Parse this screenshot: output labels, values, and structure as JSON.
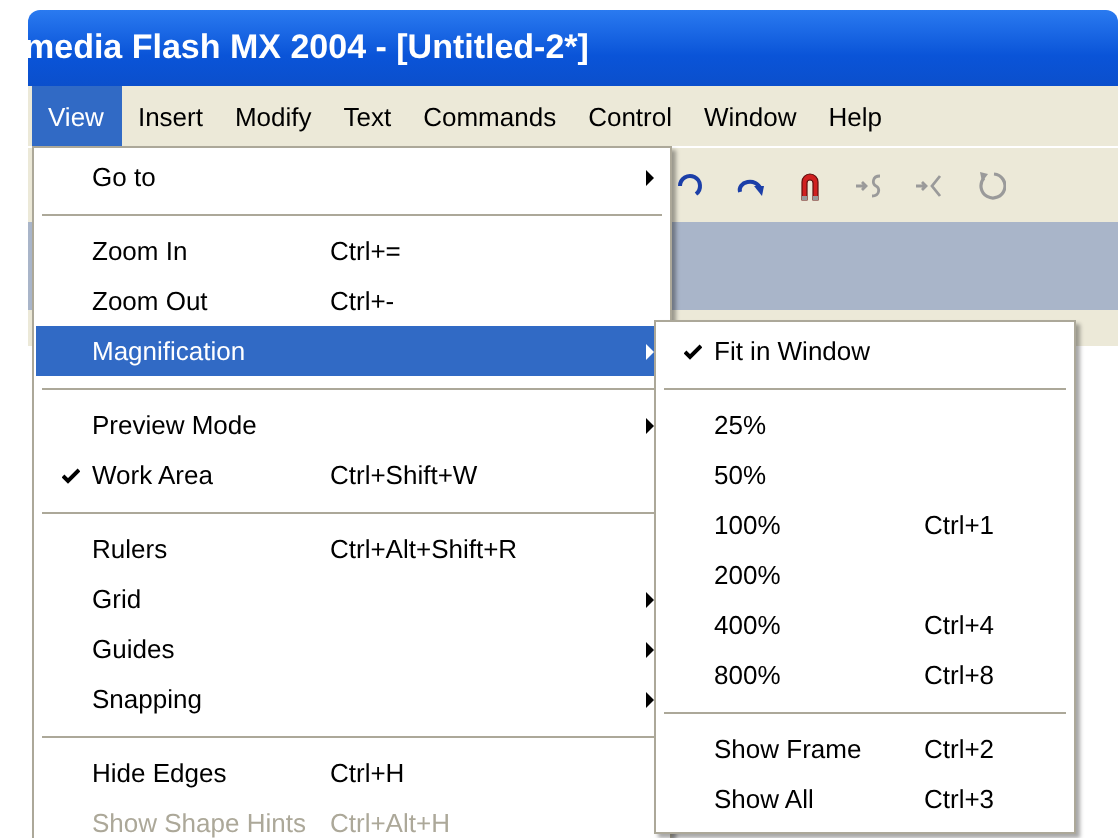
{
  "window": {
    "title": "media Flash MX 2004 - [Untitled-2*]"
  },
  "menubar": [
    {
      "label": "View",
      "selected": true
    },
    {
      "label": "Insert",
      "selected": false
    },
    {
      "label": "Modify",
      "selected": false
    },
    {
      "label": "Text",
      "selected": false
    },
    {
      "label": "Commands",
      "selected": false
    },
    {
      "label": "Control",
      "selected": false
    },
    {
      "label": "Window",
      "selected": false
    },
    {
      "label": "Help",
      "selected": false
    }
  ],
  "view_menu": [
    {
      "kind": "item",
      "label": "Go to",
      "has_submenu": true,
      "checked": false,
      "selected": false,
      "disabled": false
    },
    {
      "kind": "separator"
    },
    {
      "kind": "item",
      "label": "Zoom In",
      "shortcut": "Ctrl+=",
      "checked": false,
      "selected": false,
      "disabled": false
    },
    {
      "kind": "item",
      "label": "Zoom Out",
      "shortcut": "Ctrl+-",
      "checked": false,
      "selected": false,
      "disabled": false
    },
    {
      "kind": "item",
      "label": "Magnification",
      "has_submenu": true,
      "checked": false,
      "selected": true,
      "disabled": false
    },
    {
      "kind": "separator"
    },
    {
      "kind": "item",
      "label": "Preview Mode",
      "has_submenu": true,
      "checked": false,
      "selected": false,
      "disabled": false
    },
    {
      "kind": "item",
      "label": "Work Area",
      "shortcut": "Ctrl+Shift+W",
      "checked": true,
      "selected": false,
      "disabled": false
    },
    {
      "kind": "separator"
    },
    {
      "kind": "item",
      "label": "Rulers",
      "shortcut": "Ctrl+Alt+Shift+R",
      "checked": false,
      "selected": false,
      "disabled": false
    },
    {
      "kind": "item",
      "label": "Grid",
      "has_submenu": true,
      "checked": false,
      "selected": false,
      "disabled": false
    },
    {
      "kind": "item",
      "label": "Guides",
      "has_submenu": true,
      "checked": false,
      "selected": false,
      "disabled": false
    },
    {
      "kind": "item",
      "label": "Snapping",
      "has_submenu": true,
      "checked": false,
      "selected": false,
      "disabled": false
    },
    {
      "kind": "separator"
    },
    {
      "kind": "item",
      "label": "Hide Edges",
      "shortcut": "Ctrl+H",
      "checked": false,
      "selected": false,
      "disabled": false
    },
    {
      "kind": "item",
      "label": "Show Shape Hints",
      "shortcut": "Ctrl+Alt+H",
      "checked": false,
      "selected": false,
      "disabled": true
    }
  ],
  "magnification_menu": [
    {
      "kind": "item",
      "label": "Fit in Window",
      "checked": true,
      "selected": false,
      "disabled": false
    },
    {
      "kind": "separator"
    },
    {
      "kind": "item",
      "label": "25%",
      "checked": false,
      "selected": false,
      "disabled": false
    },
    {
      "kind": "item",
      "label": "50%",
      "checked": false,
      "selected": false,
      "disabled": false
    },
    {
      "kind": "item",
      "label": "100%",
      "shortcut": "Ctrl+1",
      "checked": false,
      "selected": false,
      "disabled": false
    },
    {
      "kind": "item",
      "label": "200%",
      "checked": false,
      "selected": false,
      "disabled": false
    },
    {
      "kind": "item",
      "label": "400%",
      "shortcut": "Ctrl+4",
      "checked": false,
      "selected": false,
      "disabled": false
    },
    {
      "kind": "item",
      "label": "800%",
      "shortcut": "Ctrl+8",
      "checked": false,
      "selected": false,
      "disabled": false
    },
    {
      "kind": "separator"
    },
    {
      "kind": "item",
      "label": "Show Frame",
      "shortcut": "Ctrl+2",
      "checked": false,
      "selected": false,
      "disabled": false
    },
    {
      "kind": "item",
      "label": "Show All",
      "shortcut": "Ctrl+3",
      "checked": false,
      "selected": false,
      "disabled": false
    }
  ]
}
